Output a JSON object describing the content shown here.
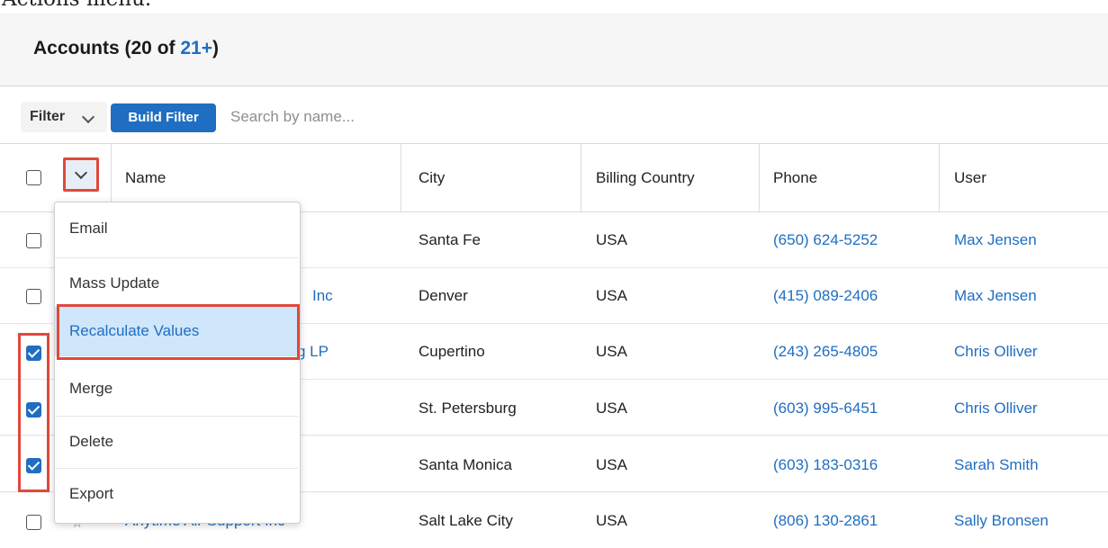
{
  "caption": "Actions menu.",
  "header": {
    "title_prefix": "Accounts (20 of ",
    "count": "21+",
    "title_suffix": ")"
  },
  "filter": {
    "dropdown_label": "Filter",
    "build_label": "Build Filter",
    "search_placeholder": "Search by name..."
  },
  "columns": {
    "name": "Name",
    "city": "City",
    "country": "Billing Country",
    "phone": "Phone",
    "user": "User"
  },
  "rows": [
    {
      "checked": false,
      "name": "",
      "city": "Santa Fe",
      "country": "USA",
      "phone": "(650) 624-5252",
      "user": "Max Jensen"
    },
    {
      "checked": false,
      "name": "Inc",
      "city": "Denver",
      "country": "USA",
      "phone": "(415) 089-2406",
      "user": "Max Jensen"
    },
    {
      "checked": true,
      "name": "g LP",
      "city": "Cupertino",
      "country": "USA",
      "phone": "(243) 265-4805",
      "user": "Chris Olliver"
    },
    {
      "checked": true,
      "name": "",
      "city": "St. Petersburg",
      "country": "USA",
      "phone": "(603) 995-6451",
      "user": "Chris Olliver"
    },
    {
      "checked": true,
      "name": "",
      "city": "Santa Monica",
      "country": "USA",
      "phone": "(603) 183-0316",
      "user": "Sarah Smith"
    },
    {
      "checked": false,
      "name": "Anytime Air Support Inc",
      "city": "Salt Lake City",
      "country": "USA",
      "phone": "(806) 130-2861",
      "user": "Sally Bronsen"
    }
  ],
  "actions_menu": {
    "items": [
      "Email",
      "Mass Update",
      "Recalculate Values",
      "Merge",
      "Delete",
      "Export"
    ],
    "highlighted": "Recalculate Values"
  },
  "colors": {
    "accent": "#1f6ec1",
    "highlight_box": "#e1483a",
    "menu_active_bg": "#cfe6fb"
  }
}
